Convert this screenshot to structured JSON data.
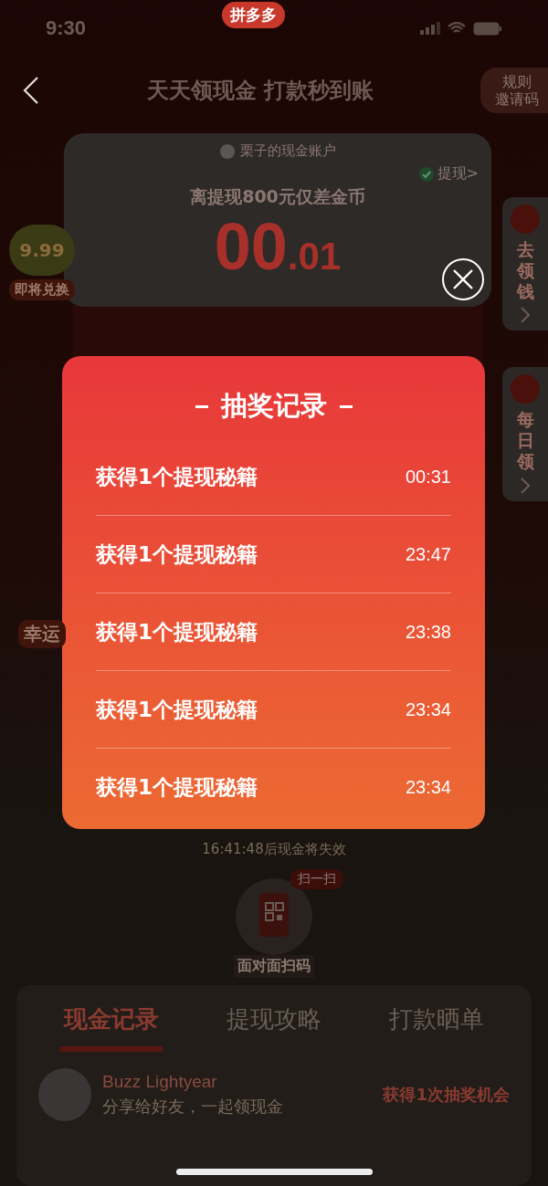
{
  "status_bar": {
    "time": "9:30",
    "app_badge": "拼多多"
  },
  "nav": {
    "title": "天天领现金 打款秒到账",
    "rules_button": [
      "规则",
      "邀请码"
    ]
  },
  "account_card": {
    "owner": "栗子的现金账户",
    "withdraw": "提现>",
    "caption": "离提现800元仅差金币",
    "amount_whole": "00",
    "amount_fraction": ".01"
  },
  "left_badges": [
    {
      "value": "9.99",
      "label": "即将兑换"
    },
    {
      "label": "幸运"
    }
  ],
  "side_tabs": [
    {
      "label": "去领钱"
    },
    {
      "label": "每日领"
    }
  ],
  "countdown": "16:41:48后现金将失效",
  "scan": {
    "tag": "扫一扫",
    "label": "面对面扫码"
  },
  "bottom_tabs": [
    {
      "label": "现金记录",
      "selected": true
    },
    {
      "label": "提现攻略",
      "selected": false
    },
    {
      "label": "打款晒单",
      "selected": false
    }
  ],
  "feed": [
    {
      "name": "Buzz Lightyear",
      "message": "分享给好友，一起领现金",
      "reward": "获得1次抽奖机会"
    }
  ],
  "modal": {
    "title": "抽奖记录",
    "records": [
      {
        "text": "获得1个提现秘籍",
        "time": "00:31"
      },
      {
        "text": "获得1个提现秘籍",
        "time": "23:47"
      },
      {
        "text": "获得1个提现秘籍",
        "time": "23:38"
      },
      {
        "text": "获得1个提现秘籍",
        "time": "23:34"
      },
      {
        "text": "获得1个提现秘籍",
        "time": "23:34"
      }
    ]
  }
}
